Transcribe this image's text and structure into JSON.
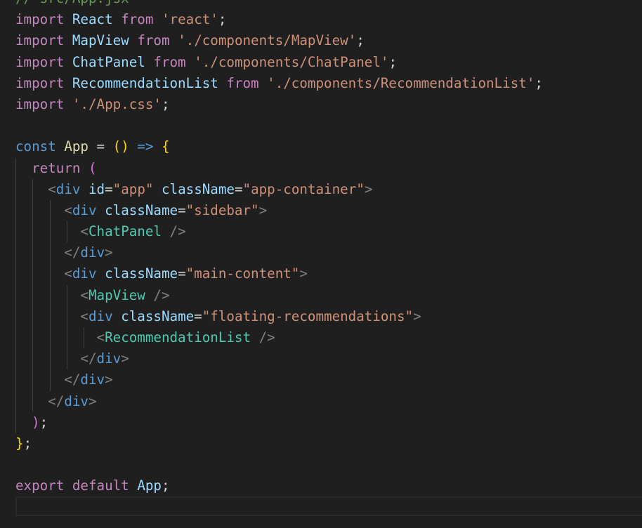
{
  "editor": {
    "lines": [
      {
        "guides": 0,
        "tokens": [
          {
            "t": "// src/App.jsx",
            "c": "cm"
          }
        ]
      },
      {
        "guides": 0,
        "tokens": [
          {
            "t": "import",
            "c": "kw"
          },
          {
            "t": " ",
            "c": "op"
          },
          {
            "t": "React",
            "c": "var"
          },
          {
            "t": " ",
            "c": "op"
          },
          {
            "t": "from",
            "c": "kw"
          },
          {
            "t": " ",
            "c": "op"
          },
          {
            "t": "'react'",
            "c": "str"
          },
          {
            "t": ";",
            "c": "punc"
          }
        ]
      },
      {
        "guides": 0,
        "tokens": [
          {
            "t": "import",
            "c": "kw"
          },
          {
            "t": " ",
            "c": "op"
          },
          {
            "t": "MapView",
            "c": "var"
          },
          {
            "t": " ",
            "c": "op"
          },
          {
            "t": "from",
            "c": "kw"
          },
          {
            "t": " ",
            "c": "op"
          },
          {
            "t": "'./components/MapView'",
            "c": "str"
          },
          {
            "t": ";",
            "c": "punc"
          }
        ]
      },
      {
        "guides": 0,
        "tokens": [
          {
            "t": "import",
            "c": "kw"
          },
          {
            "t": " ",
            "c": "op"
          },
          {
            "t": "ChatPanel",
            "c": "var"
          },
          {
            "t": " ",
            "c": "op"
          },
          {
            "t": "from",
            "c": "kw"
          },
          {
            "t": " ",
            "c": "op"
          },
          {
            "t": "'./components/ChatPanel'",
            "c": "str"
          },
          {
            "t": ";",
            "c": "punc"
          }
        ]
      },
      {
        "guides": 0,
        "tokens": [
          {
            "t": "import",
            "c": "kw"
          },
          {
            "t": " ",
            "c": "op"
          },
          {
            "t": "RecommendationList",
            "c": "var"
          },
          {
            "t": " ",
            "c": "op"
          },
          {
            "t": "from",
            "c": "kw"
          },
          {
            "t": " ",
            "c": "op"
          },
          {
            "t": "'./components/RecommendationList'",
            "c": "str"
          },
          {
            "t": ";",
            "c": "punc"
          }
        ]
      },
      {
        "guides": 0,
        "tokens": [
          {
            "t": "import",
            "c": "kw"
          },
          {
            "t": " ",
            "c": "op"
          },
          {
            "t": "'./App.css'",
            "c": "str"
          },
          {
            "t": ";",
            "c": "punc"
          }
        ]
      },
      {
        "guides": 0,
        "tokens": []
      },
      {
        "guides": 0,
        "tokens": [
          {
            "t": "const",
            "c": "kb"
          },
          {
            "t": " ",
            "c": "op"
          },
          {
            "t": "App",
            "c": "def"
          },
          {
            "t": " = ",
            "c": "op"
          },
          {
            "t": "()",
            "c": "br1"
          },
          {
            "t": " ",
            "c": "op"
          },
          {
            "t": "=>",
            "c": "kb"
          },
          {
            "t": " ",
            "c": "op"
          },
          {
            "t": "{",
            "c": "br1"
          }
        ]
      },
      {
        "guides": 1,
        "tokens": [
          {
            "t": "  ",
            "c": "op"
          },
          {
            "t": "return",
            "c": "kw"
          },
          {
            "t": " ",
            "c": "op"
          },
          {
            "t": "(",
            "c": "br2"
          }
        ]
      },
      {
        "guides": 2,
        "tokens": [
          {
            "t": "    ",
            "c": "op"
          },
          {
            "t": "<",
            "c": "tagp"
          },
          {
            "t": "div",
            "c": "tag"
          },
          {
            "t": " ",
            "c": "op"
          },
          {
            "t": "id",
            "c": "attr"
          },
          {
            "t": "=",
            "c": "op"
          },
          {
            "t": "\"app\"",
            "c": "str"
          },
          {
            "t": " ",
            "c": "op"
          },
          {
            "t": "className",
            "c": "attr"
          },
          {
            "t": "=",
            "c": "op"
          },
          {
            "t": "\"app-container\"",
            "c": "str"
          },
          {
            "t": ">",
            "c": "tagp"
          }
        ]
      },
      {
        "guides": 3,
        "tokens": [
          {
            "t": "      ",
            "c": "op"
          },
          {
            "t": "<",
            "c": "tagp"
          },
          {
            "t": "div",
            "c": "tag"
          },
          {
            "t": " ",
            "c": "op"
          },
          {
            "t": "className",
            "c": "attr"
          },
          {
            "t": "=",
            "c": "op"
          },
          {
            "t": "\"sidebar\"",
            "c": "str"
          },
          {
            "t": ">",
            "c": "tagp"
          }
        ]
      },
      {
        "guides": 4,
        "tokens": [
          {
            "t": "        ",
            "c": "op"
          },
          {
            "t": "<",
            "c": "tagp"
          },
          {
            "t": "ChatPanel",
            "c": "comp"
          },
          {
            "t": " ",
            "c": "op"
          },
          {
            "t": "/>",
            "c": "tagp"
          }
        ]
      },
      {
        "guides": 3,
        "tokens": [
          {
            "t": "      ",
            "c": "op"
          },
          {
            "t": "</",
            "c": "tagp"
          },
          {
            "t": "div",
            "c": "tag"
          },
          {
            "t": ">",
            "c": "tagp"
          }
        ]
      },
      {
        "guides": 3,
        "tokens": [
          {
            "t": "      ",
            "c": "op"
          },
          {
            "t": "<",
            "c": "tagp"
          },
          {
            "t": "div",
            "c": "tag"
          },
          {
            "t": " ",
            "c": "op"
          },
          {
            "t": "className",
            "c": "attr"
          },
          {
            "t": "=",
            "c": "op"
          },
          {
            "t": "\"main-content\"",
            "c": "str"
          },
          {
            "t": ">",
            "c": "tagp"
          }
        ]
      },
      {
        "guides": 4,
        "tokens": [
          {
            "t": "        ",
            "c": "op"
          },
          {
            "t": "<",
            "c": "tagp"
          },
          {
            "t": "MapView",
            "c": "comp"
          },
          {
            "t": " ",
            "c": "op"
          },
          {
            "t": "/>",
            "c": "tagp"
          }
        ]
      },
      {
        "guides": 4,
        "tokens": [
          {
            "t": "        ",
            "c": "op"
          },
          {
            "t": "<",
            "c": "tagp"
          },
          {
            "t": "div",
            "c": "tag"
          },
          {
            "t": " ",
            "c": "op"
          },
          {
            "t": "className",
            "c": "attr"
          },
          {
            "t": "=",
            "c": "op"
          },
          {
            "t": "\"floating-recommendations\"",
            "c": "str"
          },
          {
            "t": ">",
            "c": "tagp"
          }
        ]
      },
      {
        "guides": 5,
        "tokens": [
          {
            "t": "          ",
            "c": "op"
          },
          {
            "t": "<",
            "c": "tagp"
          },
          {
            "t": "RecommendationList",
            "c": "comp"
          },
          {
            "t": " ",
            "c": "op"
          },
          {
            "t": "/>",
            "c": "tagp"
          }
        ]
      },
      {
        "guides": 4,
        "tokens": [
          {
            "t": "        ",
            "c": "op"
          },
          {
            "t": "</",
            "c": "tagp"
          },
          {
            "t": "div",
            "c": "tag"
          },
          {
            "t": ">",
            "c": "tagp"
          }
        ]
      },
      {
        "guides": 3,
        "tokens": [
          {
            "t": "      ",
            "c": "op"
          },
          {
            "t": "</",
            "c": "tagp"
          },
          {
            "t": "div",
            "c": "tag"
          },
          {
            "t": ">",
            "c": "tagp"
          }
        ]
      },
      {
        "guides": 2,
        "tokens": [
          {
            "t": "    ",
            "c": "op"
          },
          {
            "t": "</",
            "c": "tagp"
          },
          {
            "t": "div",
            "c": "tag"
          },
          {
            "t": ">",
            "c": "tagp"
          }
        ]
      },
      {
        "guides": 1,
        "tokens": [
          {
            "t": "  ",
            "c": "op"
          },
          {
            "t": ")",
            "c": "br2"
          },
          {
            "t": ";",
            "c": "punc"
          }
        ]
      },
      {
        "guides": 0,
        "tokens": [
          {
            "t": "}",
            "c": "br1"
          },
          {
            "t": ";",
            "c": "punc"
          }
        ]
      },
      {
        "guides": 0,
        "tokens": []
      },
      {
        "guides": 0,
        "tokens": [
          {
            "t": "export",
            "c": "kw"
          },
          {
            "t": " ",
            "c": "op"
          },
          {
            "t": "default",
            "c": "kw"
          },
          {
            "t": " ",
            "c": "op"
          },
          {
            "t": "App",
            "c": "var"
          },
          {
            "t": ";",
            "c": "punc"
          }
        ]
      },
      {
        "guides": 0,
        "tokens": []
      }
    ]
  }
}
